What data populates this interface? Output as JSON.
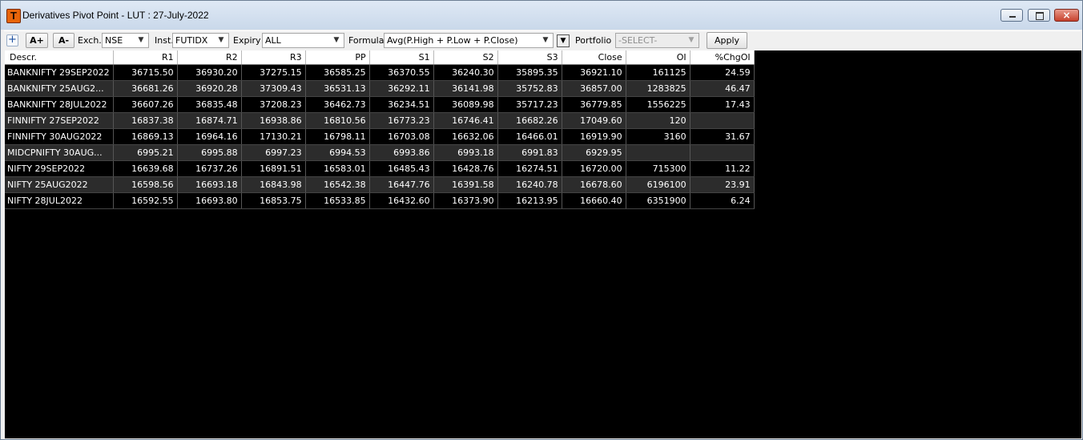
{
  "window": {
    "title": "Derivatives Pivot Point - LUT : 27-July-2022",
    "app_icon_letter": "T",
    "minimize": "minimize",
    "maximize": "maximize",
    "close": "×"
  },
  "toolbar": {
    "plus": "+",
    "font_increase": "A+",
    "font_decrease": "A-",
    "exch_label": "Exch.",
    "exch_value": "NSE",
    "inst_label": "Inst.",
    "inst_value": "FUTIDX",
    "expiry_label": "Expiry",
    "expiry_value": "ALL",
    "formula_label": "Formula",
    "formula_value": "Avg(P.High + P.Low + P.Close)",
    "portfolio_label": "Portfolio",
    "portfolio_value": "-SELECT-",
    "apply_label": "Apply",
    "dropdown_arrow": "▼",
    "toggle_arrow": "▼"
  },
  "table": {
    "columns": [
      "Descr.",
      "R1",
      "R2",
      "R3",
      "PP",
      "S1",
      "S2",
      "S3",
      "Close",
      "OI",
      "%ChgOI"
    ],
    "rows": [
      [
        "BANKNIFTY 29SEP2022",
        "36715.50",
        "36930.20",
        "37275.15",
        "36585.25",
        "36370.55",
        "36240.30",
        "35895.35",
        "36921.10",
        "161125",
        "24.59"
      ],
      [
        "BANKNIFTY 25AUG2...",
        "36681.26",
        "36920.28",
        "37309.43",
        "36531.13",
        "36292.11",
        "36141.98",
        "35752.83",
        "36857.00",
        "1283825",
        "46.47"
      ],
      [
        "BANKNIFTY 28JUL2022",
        "36607.26",
        "36835.48",
        "37208.23",
        "36462.73",
        "36234.51",
        "36089.98",
        "35717.23",
        "36779.85",
        "1556225",
        "17.43"
      ],
      [
        "FINNIFTY 27SEP2022",
        "16837.38",
        "16874.71",
        "16938.86",
        "16810.56",
        "16773.23",
        "16746.41",
        "16682.26",
        "17049.60",
        "120",
        ""
      ],
      [
        "FINNIFTY 30AUG2022",
        "16869.13",
        "16964.16",
        "17130.21",
        "16798.11",
        "16703.08",
        "16632.06",
        "16466.01",
        "16919.90",
        "3160",
        "31.67"
      ],
      [
        "MIDCPNIFTY 30AUG...",
        "6995.21",
        "6995.88",
        "6997.23",
        "6994.53",
        "6993.86",
        "6993.18",
        "6991.83",
        "6929.95",
        "",
        ""
      ],
      [
        "NIFTY 29SEP2022",
        "16639.68",
        "16737.26",
        "16891.51",
        "16583.01",
        "16485.43",
        "16428.76",
        "16274.51",
        "16720.00",
        "715300",
        "11.22"
      ],
      [
        "NIFTY 25AUG2022",
        "16598.56",
        "16693.18",
        "16843.98",
        "16542.38",
        "16447.76",
        "16391.58",
        "16240.78",
        "16678.60",
        "6196100",
        "23.91"
      ],
      [
        "NIFTY 28JUL2022",
        "16592.55",
        "16693.80",
        "16853.75",
        "16533.85",
        "16432.60",
        "16373.90",
        "16213.95",
        "16660.40",
        "6351900",
        "6.24"
      ]
    ]
  }
}
